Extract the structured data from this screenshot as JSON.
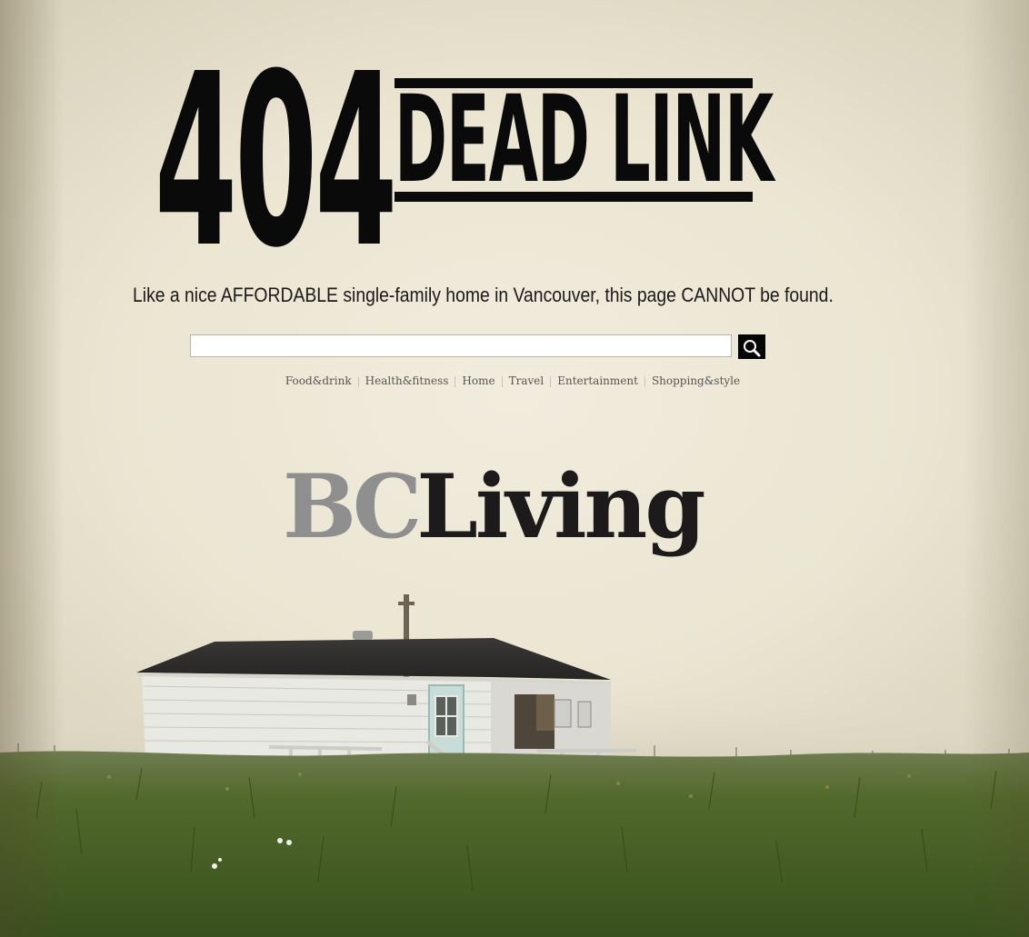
{
  "headline": {
    "code": "404",
    "title": "DEAD LINK"
  },
  "tagline": "Like a nice AFFORDABLE single-family home in Vancouver, this page CANNOT be found.",
  "search": {
    "value": "",
    "placeholder": "",
    "button_icon": "search-icon"
  },
  "nav": {
    "items": [
      {
        "label": "Food&drink"
      },
      {
        "label": "Health&fitness"
      },
      {
        "label": "Home"
      },
      {
        "label": "Travel"
      },
      {
        "label": "Entertainment"
      },
      {
        "label": "Shopping&style"
      }
    ]
  },
  "logo": {
    "part1": "BC",
    "part2": "Living"
  },
  "colors": {
    "background": "#ece7d6",
    "headline": "#0a0a0a",
    "logo_bc": "#8f8f8f",
    "logo_living": "#1c1a1a",
    "grass": "#4e6a2a"
  }
}
